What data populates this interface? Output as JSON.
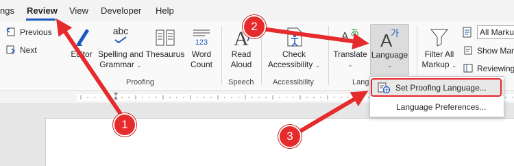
{
  "tabs": [
    {
      "label": "ngs"
    },
    {
      "label": "Review",
      "active": true
    },
    {
      "label": "View"
    },
    {
      "label": "Developer"
    },
    {
      "label": "Help"
    }
  ],
  "ribbon": {
    "tracking_nav": {
      "previous": "Previous",
      "next": "Next"
    },
    "editor": {
      "label": "Editor"
    },
    "spelling": {
      "line1": "Spelling and",
      "line2": "Grammar"
    },
    "thesaurus": {
      "label": "Thesaurus"
    },
    "word_count": {
      "line1": "Word",
      "line2": "Count",
      "icon_text": "123"
    },
    "read_aloud": {
      "line1": "Read",
      "line2": "Aloud"
    },
    "check_accessibility": {
      "line1": "Check",
      "line2": "Accessibility"
    },
    "translate": {
      "label": "Translate"
    },
    "language": {
      "label": "Language",
      "icon_text": "가"
    },
    "filter_all_markup": {
      "line1": "Filter All",
      "line2": "Markup"
    },
    "all_markup_select": {
      "value": "All Markup"
    },
    "show_markup": {
      "label": "Show Mark"
    },
    "reviewing": {
      "label": "Reviewing"
    },
    "groups": {
      "proofing": "Proofing",
      "speech": "Speech",
      "accessibility": "Accessibility",
      "language": "Lang"
    }
  },
  "icons": {
    "spelling_abc": "abc"
  },
  "language_menu": {
    "set_proofing": "Set Proofing Language...",
    "preferences": "Language Preferences..."
  },
  "annotations": {
    "marker1": "1",
    "marker2": "2",
    "marker3": "3"
  },
  "colors": {
    "accent": "#185abd",
    "annotation_red": "#e52b2b"
  }
}
